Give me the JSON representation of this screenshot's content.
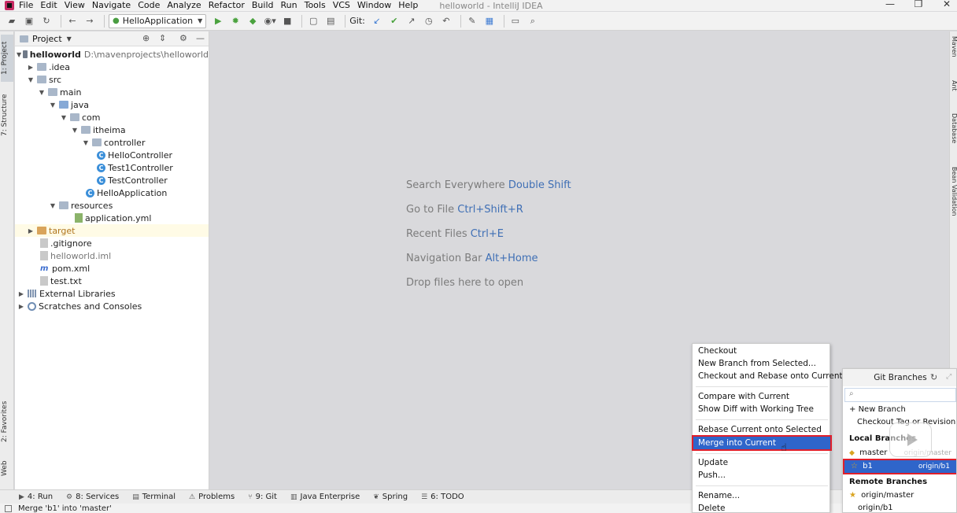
{
  "menubar": {
    "items": [
      "File",
      "Edit",
      "View",
      "Navigate",
      "Code",
      "Analyze",
      "Refactor",
      "Build",
      "Run",
      "Tools",
      "VCS",
      "Window",
      "Help"
    ],
    "window_title": "helloworld - IntelliJ IDEA"
  },
  "toolbar": {
    "run_config": "HelloApplication",
    "git_label": "Git:"
  },
  "left_stripe": {
    "project_tab": "1: Project",
    "structure_tab": "7: Structure",
    "favorites_tab": "2: Favorites",
    "web_tab": "Web"
  },
  "project_panel": {
    "title": "Project",
    "tree": [
      {
        "label": "helloworld",
        "extra": "D:\\mavenprojects\\helloworld"
      },
      {
        "label": ".idea"
      },
      {
        "label": "src"
      },
      {
        "label": "main"
      },
      {
        "label": "java"
      },
      {
        "label": "com"
      },
      {
        "label": "itheima"
      },
      {
        "label": "controller"
      },
      {
        "label": "HelloController"
      },
      {
        "label": "Test1Controller"
      },
      {
        "label": "TestController"
      },
      {
        "label": "HelloApplication"
      },
      {
        "label": "resources"
      },
      {
        "label": "application.yml"
      },
      {
        "label": "target"
      },
      {
        "label": ".gitignore"
      },
      {
        "label": "helloworld.iml"
      },
      {
        "label": "pom.xml"
      },
      {
        "label": "test.txt"
      },
      {
        "label": "External Libraries"
      },
      {
        "label": "Scratches and Consoles"
      }
    ]
  },
  "editor_hints": [
    {
      "text": "Search Everywhere",
      "key": "Double Shift"
    },
    {
      "text": "Go to File",
      "key": "Ctrl+Shift+R"
    },
    {
      "text": "Recent Files",
      "key": "Ctrl+E"
    },
    {
      "text": "Navigation Bar",
      "key": "Alt+Home"
    },
    {
      "text": "Drop files here to open",
      "key": ""
    }
  ],
  "right_stripe": [
    "Maven",
    "Ant",
    "Database",
    "Bean Validation"
  ],
  "bottom_bar": [
    {
      "num": "4",
      "label": "Run"
    },
    {
      "num": "8",
      "label": "Services"
    },
    {
      "num": "",
      "label": "Terminal"
    },
    {
      "num": "",
      "label": "Problems"
    },
    {
      "num": "9",
      "label": "Git"
    },
    {
      "num": "",
      "label": "Java Enterprise"
    },
    {
      "num": "",
      "label": "Spring"
    },
    {
      "num": "6",
      "label": "TODO"
    }
  ],
  "status_bar": {
    "message": "Merge 'b1' into 'master'"
  },
  "context_menu": {
    "items": [
      "Checkout",
      "New Branch from Selected...",
      "Checkout and Rebase onto Current",
      "Compare with Current",
      "Show Diff with Working Tree",
      "Rebase Current onto Selected",
      "Merge into Current",
      "Update",
      "Push...",
      "Rename...",
      "Delete"
    ],
    "selected": "Merge into Current"
  },
  "git_branches": {
    "title": "Git Branches",
    "new_branch": "New Branch",
    "checkout_tag": "Checkout Tag or Revision...",
    "local_header": "Local Branches",
    "local": [
      {
        "name": "master",
        "tracking": "origin/master"
      },
      {
        "name": "b1",
        "tracking": "origin/b1"
      }
    ],
    "remote_header": "Remote Branches",
    "remote": [
      "origin/master",
      "origin/b1"
    ]
  },
  "colors": {
    "selection": "#2f65ca",
    "highlight_box": "#e01e2a",
    "editor_bg": "#d9d9dc",
    "hint_key": "#3f6fb5"
  }
}
